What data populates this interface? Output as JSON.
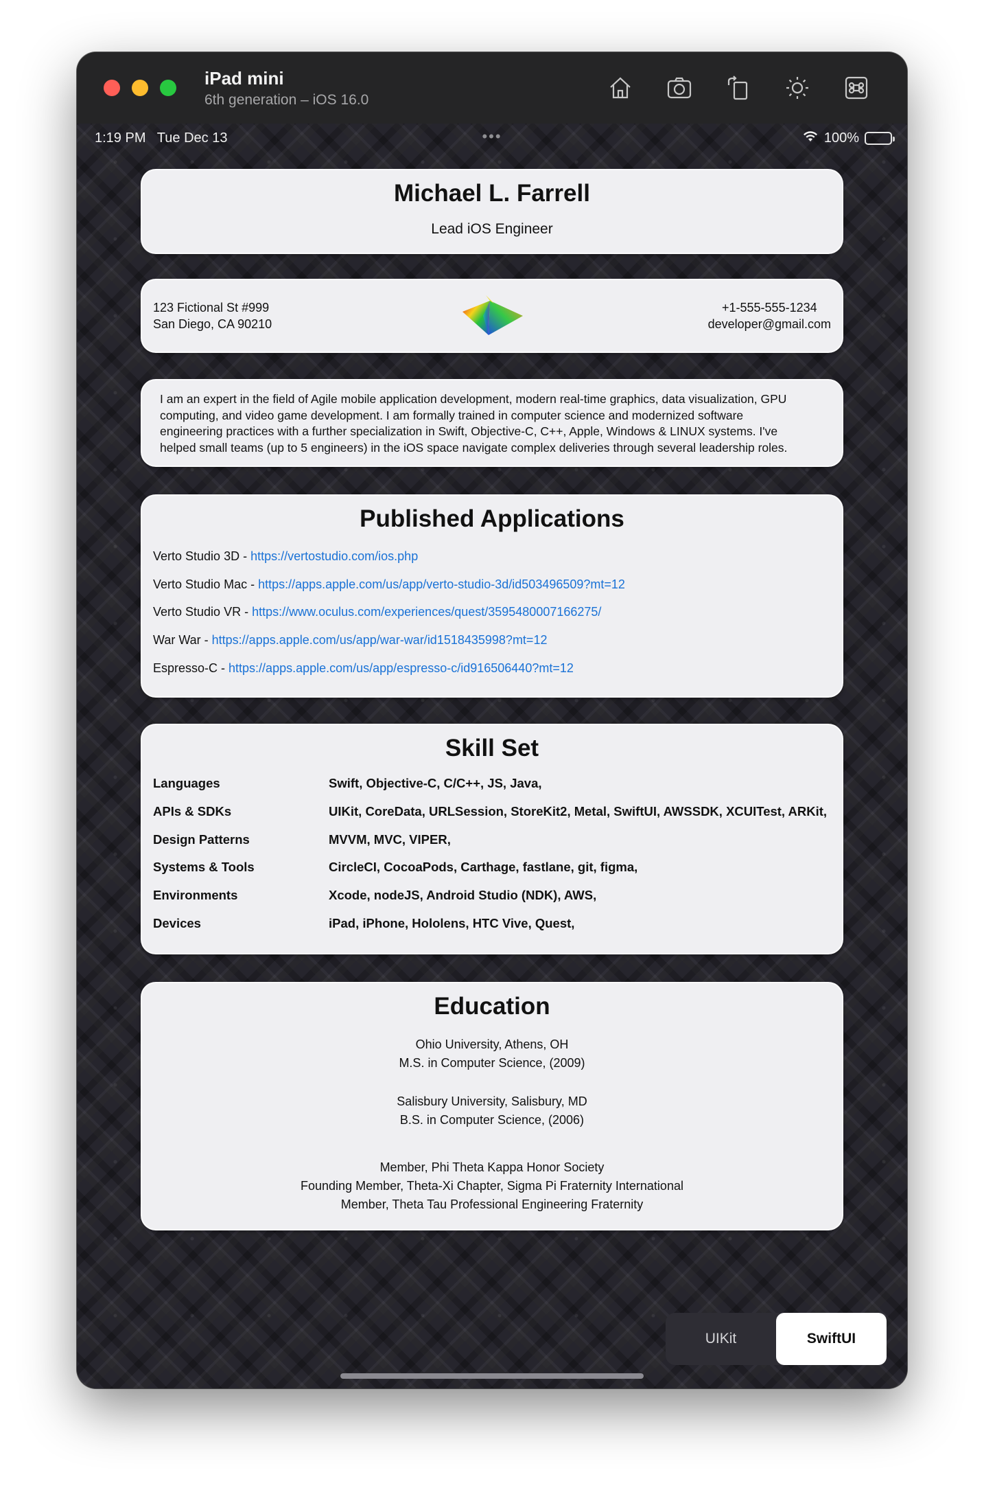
{
  "window": {
    "title": "iPad mini",
    "subtitle": "6th generation – iOS 16.0",
    "toolbar_icons": [
      "home-icon",
      "screenshot-icon",
      "rotate-icon",
      "appearance-icon",
      "command-icon"
    ]
  },
  "status": {
    "time": "1:19 PM",
    "date": "Tue Dec 13",
    "more": "•••",
    "battery": "100%"
  },
  "header": {
    "name": "Michael L. Farrell",
    "role": "Lead iOS Engineer"
  },
  "contact": {
    "address_line1": "123 Fictional St #999",
    "address_line2": "San Diego, CA 90210",
    "phone": "+1-555-555-1234",
    "email": "developer@gmail.com"
  },
  "bio": {
    "line1": "I am an expert in the field of Agile mobile application development, modern real-time graphics, data visualization, GPU",
    "line2": "computing, and video game development. I am formally trained in computer science and modernized software",
    "line3": "engineering practices with a further specialization in Swift, Objective-C, C++, Apple, Windows & LINUX systems. I've",
    "line4": "helped small teams (up to 5 engineers) in the iOS space navigate complex deliveries through several leadership roles."
  },
  "published": {
    "title": "Published Applications",
    "apps": [
      {
        "name": "Verto Studio 3D - ",
        "url": "https://vertostudio.com/ios.php"
      },
      {
        "name": "Verto Studio Mac - ",
        "url": "https://apps.apple.com/us/app/verto-studio-3d/id503496509?mt=12"
      },
      {
        "name": "Verto Studio VR - ",
        "url": "https://www.oculus.com/experiences/quest/3595480007166275/"
      },
      {
        "name": "War War - ",
        "url": "https://apps.apple.com/us/app/war-war/id1518435998?mt=12"
      },
      {
        "name": "Espresso-C - ",
        "url": "https://apps.apple.com/us/app/espresso-c/id916506440?mt=12"
      }
    ]
  },
  "skills": {
    "title": "Skill Set",
    "rows": [
      {
        "category": "Languages",
        "items": "Swift, Objective-C, C/C++, JS, Java,"
      },
      {
        "category": "APIs & SDKs",
        "items": "UIKit, CoreData, URLSession, StoreKit2, Metal, SwiftUI, AWSSDK, XCUITest, ARKit,"
      },
      {
        "category": "Design Patterns",
        "items": "MVVM, MVC, VIPER,"
      },
      {
        "category": "Systems & Tools",
        "items": "CircleCI, CocoaPods, Carthage, fastlane, git, figma,"
      },
      {
        "category": "Environments",
        "items": "Xcode, nodeJS, Android Studio (NDK), AWS,"
      },
      {
        "category": "Devices",
        "items": "iPad, iPhone, Hololens, HTC Vive, Quest,"
      }
    ]
  },
  "education": {
    "title": "Education",
    "school1": "Ohio University, Athens, OH",
    "degree1": "M.S. in Computer Science, (2009)",
    "school2": "Salisbury University, Salisbury, MD",
    "degree2": "B.S. in Computer Science, (2006)",
    "honor1": "Member,  Phi Theta Kappa Honor Society",
    "honor2": "Founding Member, Theta-Xi Chapter,  Sigma Pi Fraternity International",
    "honor3": "Member,  Theta Tau Professional Engineering Fraternity"
  },
  "segmented": {
    "option1": "UIKit",
    "option2": "SwiftUI",
    "selected": "SwiftUI"
  },
  "colors": {
    "link": "#1a72d6",
    "card_bg": "#efeff2",
    "screen_bg": "#26252d"
  }
}
